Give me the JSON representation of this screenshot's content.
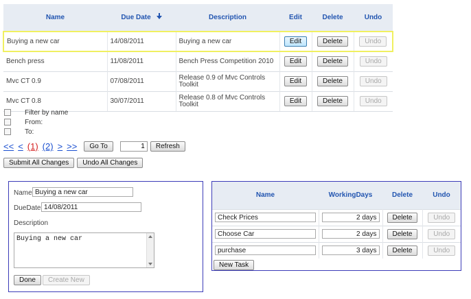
{
  "grid": {
    "columns": {
      "name": "Name",
      "due_date": "Due Date",
      "description": "Description",
      "edit": "Edit",
      "delete": "Delete",
      "undo": "Undo"
    },
    "sort_icon": "down-arrow-icon",
    "rows": [
      {
        "name": "Buying a new car",
        "due_date": "14/08/2011",
        "description": "Buying a new car",
        "edit": "Edit",
        "delete": "Delete",
        "undo": "Undo",
        "selected": true
      },
      {
        "name": "Bench press",
        "due_date": "11/08/2011",
        "description": "Bench Press Competition 2010",
        "edit": "Edit",
        "delete": "Delete",
        "undo": "Undo",
        "selected": false
      },
      {
        "name": "Mvc CT 0.9",
        "due_date": "07/08/2011",
        "description": "Release  0.9 of Mvc Controls Toolkit",
        "edit": "Edit",
        "delete": "Delete",
        "undo": "Undo",
        "selected": false
      },
      {
        "name": "Mvc CT 0.8",
        "due_date": "30/07/2011",
        "description": "Release  0.8 of Mvc Controls Toolkit",
        "edit": "Edit",
        "delete": "Delete",
        "undo": "Undo",
        "selected": false
      }
    ]
  },
  "filters": {
    "filter_by_name": "Filter by name",
    "from": "From:",
    "to": "To:"
  },
  "pager": {
    "first": "<<",
    "prev": "<",
    "page1": "(1)",
    "page2": "(2)",
    "next": ">",
    "last": ">>",
    "goto_label": "Go To",
    "goto_value": "1",
    "refresh_label": "Refresh"
  },
  "actions": {
    "submit_all": "Submit All Changes",
    "undo_all": "Undo All Changes"
  },
  "detail_form": {
    "name_label": "Name",
    "name_value": "Buying a new car",
    "due_date_label": "DueDate",
    "due_date_value": "14/08/2011",
    "description_label": "Description",
    "description_value": "Buying a new car",
    "done_label": "Done",
    "create_new_label": "Create New"
  },
  "tasks": {
    "columns": {
      "name": "Name",
      "working_days": "WorkingDays",
      "delete": "Delete",
      "undo": "Undo"
    },
    "rows": [
      {
        "name": "Check Prices",
        "days": "2 days",
        "delete": "Delete",
        "undo": "Undo"
      },
      {
        "name": "Choose Car",
        "days": "2 days",
        "delete": "Delete",
        "undo": "Undo"
      },
      {
        "name": "purchase",
        "days": "3 days",
        "delete": "Delete",
        "undo": "Undo"
      }
    ],
    "new_task_label": "New Task"
  },
  "colors": {
    "header_bg": "#e7ecf3",
    "header_text": "#2255b0",
    "selected_row_border": "#f0f060",
    "panel_border": "#3b3bb8",
    "current_page": "#d42020",
    "link": "#1a4fd0"
  }
}
